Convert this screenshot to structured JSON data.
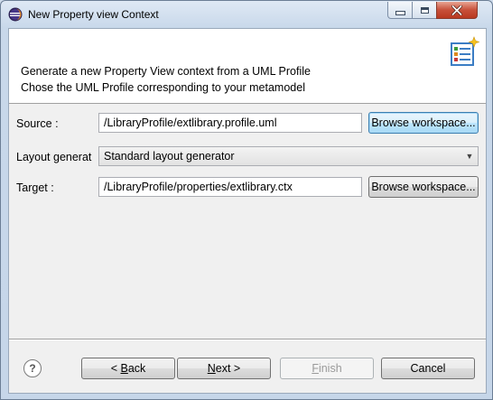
{
  "window": {
    "title": "New Property view Context",
    "accent_color": "#c6d6e9"
  },
  "banner": {
    "line1": "Generate a new Property View context from a UML Profile",
    "line2": "Chose the UML Profile corresponding to your metamodel"
  },
  "form": {
    "source_label": "Source :",
    "source_value": "/LibraryProfile/extlibrary.profile.uml",
    "source_browse": "Browse workspace...",
    "layout_label": "Layout generat",
    "layout_value": "Standard layout generator",
    "target_label": "Target :",
    "target_value": "/LibraryProfile/properties/extlibrary.ctx",
    "target_browse": "Browse workspace..."
  },
  "footer": {
    "help_glyph": "?",
    "back_mnemonic": "B",
    "back_rest": "ack",
    "back_prefix": "< ",
    "next_mnemonic": "N",
    "next_rest": "ext >",
    "finish_mnemonic": "F",
    "finish_rest": "inish",
    "cancel_label": "Cancel"
  }
}
